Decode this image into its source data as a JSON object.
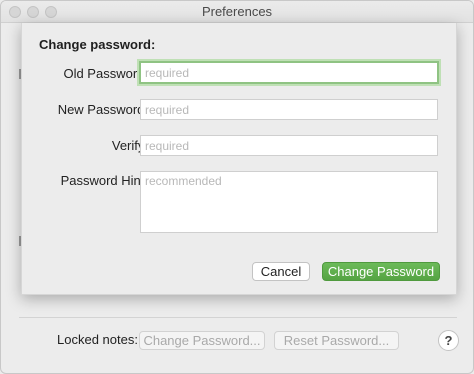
{
  "window": {
    "title": "Preferences"
  },
  "sheet": {
    "heading": "Change password:",
    "fields": [
      {
        "label": "Old Password:",
        "value": "",
        "placeholder": "required"
      },
      {
        "label": "New Password:",
        "value": "",
        "placeholder": "required"
      },
      {
        "label": "Verify:",
        "value": "",
        "placeholder": "required"
      },
      {
        "label": "Password Hint:",
        "value": "",
        "placeholder": "recommended"
      }
    ],
    "cancel_label": "Cancel",
    "submit_label": "Change Password"
  },
  "footer": {
    "label": "Locked notes:",
    "change_password_label": "Change Password...",
    "reset_password_label": "Reset Password...",
    "help_label": "?"
  }
}
